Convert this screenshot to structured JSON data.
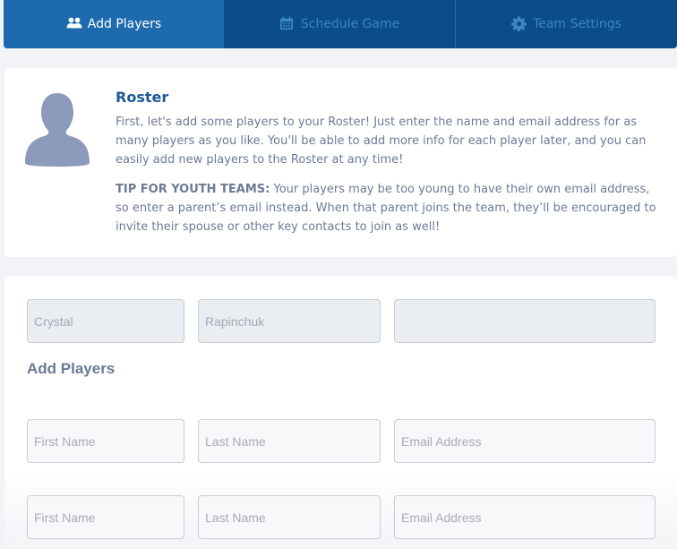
{
  "tabs": [
    {
      "label": "Add Players",
      "icon": "users-icon",
      "active": true
    },
    {
      "label": "Schedule Game",
      "icon": "calendar-icon",
      "active": false
    },
    {
      "label": "Team Settings",
      "icon": "gear-icon",
      "active": false
    }
  ],
  "intro": {
    "title": "Roster",
    "paragraph1": "First, let's add some players to your Roster! Just enter the name and email address for as many players as you like. You'll be able to add more info for each player later, and you can easily add new players to the Roster at any time!",
    "tip_label": "TIP FOR YOUTH TEAMS:",
    "tip_text": " Your players may be too young to have their own email address, so enter a parent’s email instead. When that parent joins the team, they’ll be encouraged to invite their spouse or other key contacts to join as well!"
  },
  "existing_player": {
    "first_name": "Crystal",
    "last_name": "Rapinchuk",
    "email": ""
  },
  "add_players": {
    "title": "Add Players",
    "rows": [
      {
        "first_placeholder": "First Name",
        "last_placeholder": "Last Name",
        "email_placeholder": "Email Address"
      },
      {
        "first_placeholder": "First Name",
        "last_placeholder": "Last Name",
        "email_placeholder": "Email Address"
      }
    ]
  },
  "colors": {
    "tab_active": "#1d6aae",
    "tab_inactive": "#0b4c89",
    "title_blue": "#1b5a96",
    "body_text": "#6c7a96",
    "avatar": "#8c9bbb"
  }
}
